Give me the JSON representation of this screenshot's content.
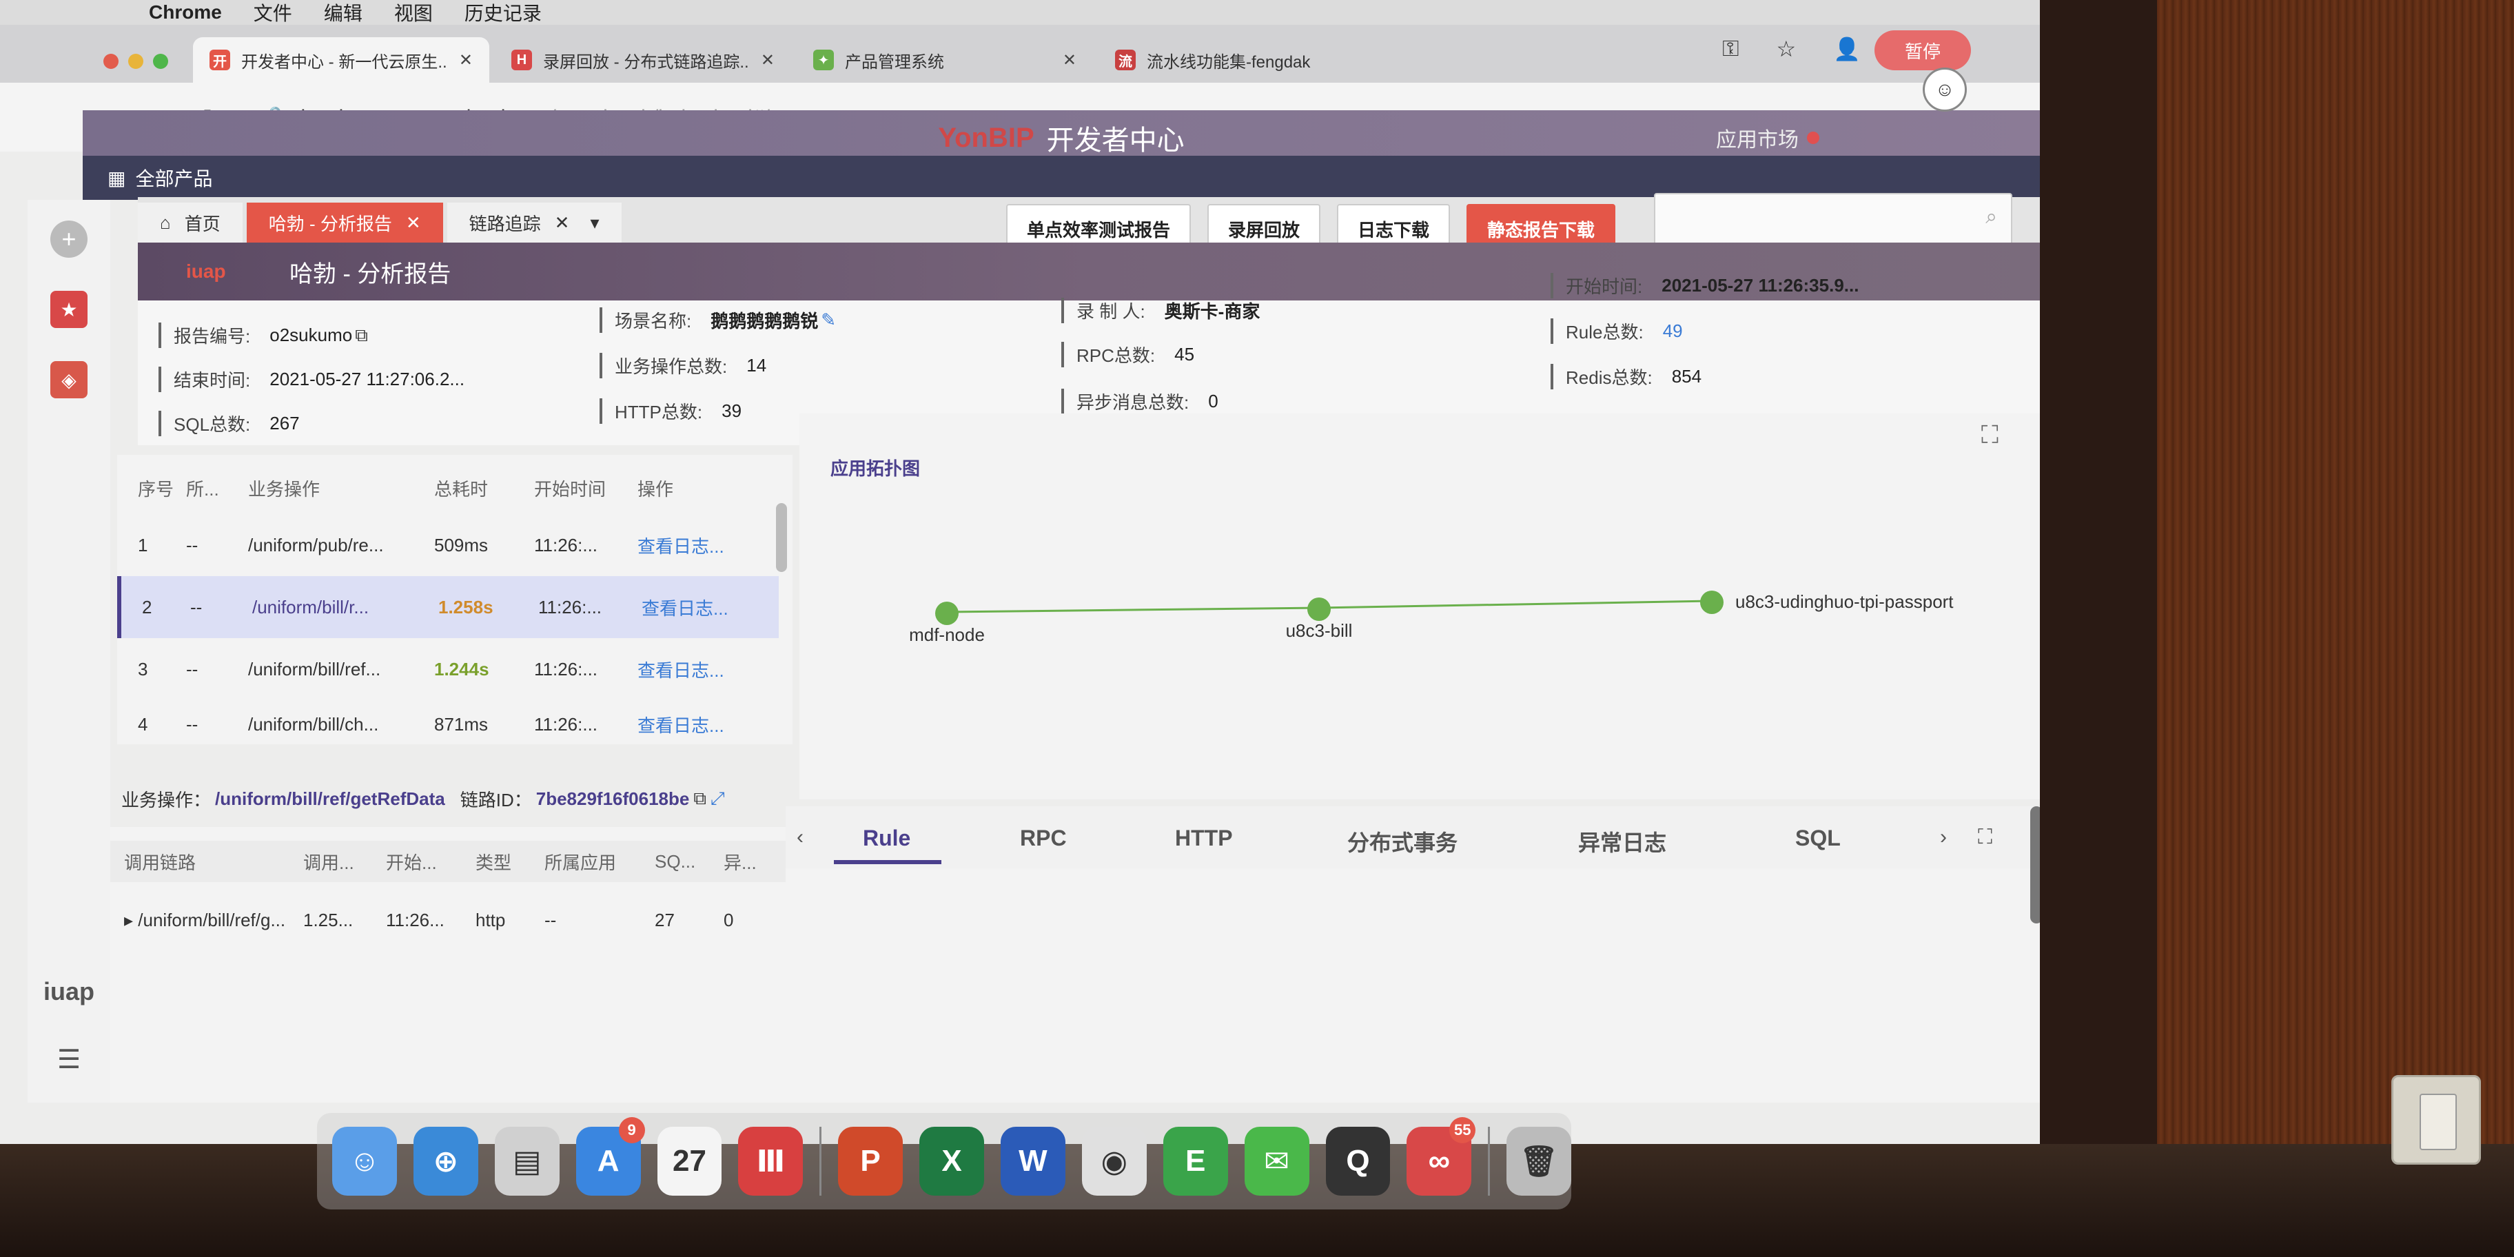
{
  "menubar": {
    "app": "Chrome",
    "items": [
      "文件",
      "编辑",
      "视图",
      "历史记录"
    ]
  },
  "browser_tabs": [
    {
      "label": "开发者中心 - 新一代云原生...",
      "icon_letter": "开",
      "icon_color": "#e45648"
    },
    {
      "label": "录屏回放 - 分布式链路追踪...",
      "icon_letter": "H",
      "icon_color": "#d84848"
    },
    {
      "label": "产品管理系统",
      "icon_letter": "✦",
      "icon_color": "#6ab04c"
    },
    {
      "label": "流水线功能集-fengdak",
      "icon_letter": "流",
      "icon_color": "#c84040"
    }
  ],
  "browser_pause_label": "暂停",
  "address": {
    "host": "developer.yonyoucloud.com",
    "path": "/portal-web/index.html#/"
  },
  "portal": {
    "brand": "YonBIP",
    "title": "开发者中心",
    "market": "应用市场"
  },
  "products_label": "全部产品",
  "page_tabs": [
    {
      "label": "首页",
      "icon": "home-icon"
    },
    {
      "label": "哈勃 - 分析报告"
    },
    {
      "label": "链路追踪"
    }
  ],
  "toolbar": {
    "single_test_report": "单点效率测试报告",
    "replay": "录屏回放",
    "log_download": "日志下载",
    "static_report_download": "静态报告下载"
  },
  "report": {
    "title": "哈勃 - 分析报告",
    "logo": "iuap",
    "report_no_label": "报告编号:",
    "report_no": "o2sukumo",
    "end_time_label": "结束时间:",
    "end_time": "2021-05-27 11:27:06.2...",
    "sql_total_label": "SQL总数:",
    "sql_total": "267",
    "scene_name_label": "场景名称:",
    "scene_name": "鹅鹅鹅鹅鹅锐",
    "biz_ops_label": "业务操作总数:",
    "biz_ops": "14",
    "http_total_label": "HTTP总数:",
    "http_total": "39",
    "recorder_label": "录 制 人:",
    "recorder": "奥斯卡-商家",
    "rpc_total_label": "RPC总数:",
    "rpc_total": "45",
    "async_msg_label": "异步消息总数:",
    "async_msg": "0",
    "start_time_label": "开始时间:",
    "start_time": "2021-05-27 11:26:35.9...",
    "rule_total_label": "Rule总数:",
    "rule_total": "49",
    "redis_total_label": "Redis总数:",
    "redis_total": "854"
  },
  "op_table": {
    "headers": [
      "序号",
      "所...",
      "业务操作",
      "总耗时",
      "开始时间",
      "操作"
    ],
    "rows": [
      {
        "no": "1",
        "owner": "--",
        "op": "/uniform/pub/re...",
        "dur": "509ms",
        "start": "11:26:...",
        "action": "查看日志..."
      },
      {
        "no": "2",
        "owner": "--",
        "op": "/uniform/bill/r...",
        "dur": "1.258s",
        "start": "11:26:...",
        "action": "查看日志..."
      },
      {
        "no": "3",
        "owner": "--",
        "op": "/uniform/bill/ref...",
        "dur": "1.244s",
        "start": "11:26:...",
        "action": "查看日志..."
      },
      {
        "no": "4",
        "owner": "--",
        "op": "/uniform/bill/ch...",
        "dur": "871ms",
        "start": "11:26:...",
        "action": "查看日志..."
      }
    ]
  },
  "chain": {
    "op_label": "业务操作：",
    "op_value": "/uniform/bill/ref/getRefData",
    "id_label": "链路ID：",
    "id_value": "7be829f16f0618be",
    "headers": [
      "调用链路",
      "调用...",
      "开始...",
      "类型",
      "所属应用",
      "SQ...",
      "异..."
    ],
    "row": [
      "/uniform/bill/ref/g...",
      "1.25...",
      "11:26...",
      "http",
      "--",
      "27",
      "0"
    ]
  },
  "topology": {
    "caption": "应用拓扑图",
    "nodes": [
      "mdf-node",
      "u8c3-bill",
      "u8c3-udinghuo-tpi-passport"
    ],
    "node_color": "#6ab04c"
  },
  "detail_tabs": [
    "Rule",
    "RPC",
    "HTTP",
    "分布式事务",
    "异常日志",
    "SQL"
  ],
  "rail": {
    "iuap": "iuap"
  },
  "dock": {
    "apps": [
      {
        "name": "finder",
        "glyph": "☺",
        "color": "#5a9ee8"
      },
      {
        "name": "safari",
        "glyph": "⊕",
        "color": "#3a8ad8"
      },
      {
        "name": "preview",
        "glyph": "▤",
        "color": "#d0d0d0"
      },
      {
        "name": "app-store",
        "glyph": "A",
        "color": "#3a86e0",
        "badge": "9"
      },
      {
        "name": "calendar",
        "glyph": "27",
        "color": "#f4f4f4"
      },
      {
        "name": "iuap-app",
        "glyph": "Ⅲ",
        "color": "#d84040"
      },
      {
        "name": "powerpoint",
        "glyph": "P",
        "color": "#d04a2a"
      },
      {
        "name": "excel",
        "glyph": "X",
        "color": "#1f7a42"
      },
      {
        "name": "word",
        "glyph": "W",
        "color": "#2b5bb8"
      },
      {
        "name": "chrome",
        "glyph": "◉",
        "color": "#e0e0e0"
      },
      {
        "name": "evernote",
        "glyph": "E",
        "color": "#3aa44a"
      },
      {
        "name": "wechat",
        "glyph": "✉",
        "color": "#4ab84a"
      },
      {
        "name": "qq",
        "glyph": "Q",
        "color": "#333333"
      },
      {
        "name": "yonyou-app",
        "glyph": "∞",
        "color": "#d84848",
        "badge": "55"
      },
      {
        "name": "trash",
        "glyph": "🗑",
        "color": "#bbbbbb"
      }
    ]
  }
}
